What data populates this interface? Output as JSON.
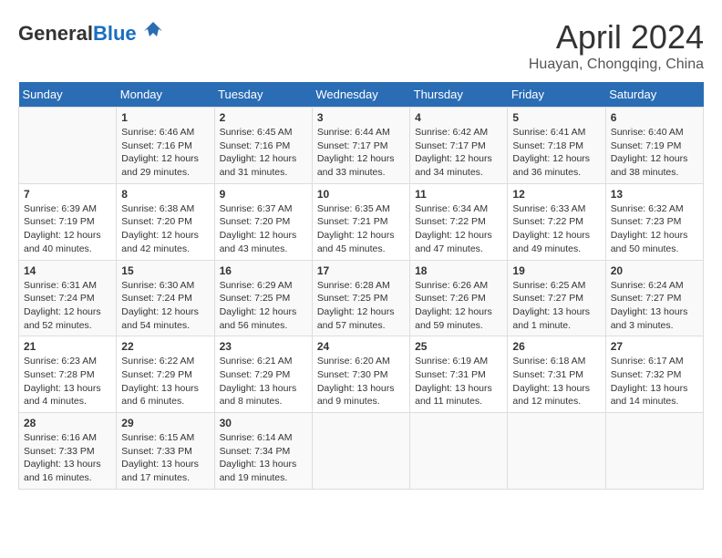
{
  "header": {
    "logo_general": "General",
    "logo_blue": "Blue",
    "month_title": "April 2024",
    "location": "Huayan, Chongqing, China"
  },
  "weekdays": [
    "Sunday",
    "Monday",
    "Tuesday",
    "Wednesday",
    "Thursday",
    "Friday",
    "Saturday"
  ],
  "weeks": [
    [
      {
        "day": "",
        "sunrise": "",
        "sunset": "",
        "daylight": ""
      },
      {
        "day": "1",
        "sunrise": "Sunrise: 6:46 AM",
        "sunset": "Sunset: 7:16 PM",
        "daylight": "Daylight: 12 hours and 29 minutes."
      },
      {
        "day": "2",
        "sunrise": "Sunrise: 6:45 AM",
        "sunset": "Sunset: 7:16 PM",
        "daylight": "Daylight: 12 hours and 31 minutes."
      },
      {
        "day": "3",
        "sunrise": "Sunrise: 6:44 AM",
        "sunset": "Sunset: 7:17 PM",
        "daylight": "Daylight: 12 hours and 33 minutes."
      },
      {
        "day": "4",
        "sunrise": "Sunrise: 6:42 AM",
        "sunset": "Sunset: 7:17 PM",
        "daylight": "Daylight: 12 hours and 34 minutes."
      },
      {
        "day": "5",
        "sunrise": "Sunrise: 6:41 AM",
        "sunset": "Sunset: 7:18 PM",
        "daylight": "Daylight: 12 hours and 36 minutes."
      },
      {
        "day": "6",
        "sunrise": "Sunrise: 6:40 AM",
        "sunset": "Sunset: 7:19 PM",
        "daylight": "Daylight: 12 hours and 38 minutes."
      }
    ],
    [
      {
        "day": "7",
        "sunrise": "Sunrise: 6:39 AM",
        "sunset": "Sunset: 7:19 PM",
        "daylight": "Daylight: 12 hours and 40 minutes."
      },
      {
        "day": "8",
        "sunrise": "Sunrise: 6:38 AM",
        "sunset": "Sunset: 7:20 PM",
        "daylight": "Daylight: 12 hours and 42 minutes."
      },
      {
        "day": "9",
        "sunrise": "Sunrise: 6:37 AM",
        "sunset": "Sunset: 7:20 PM",
        "daylight": "Daylight: 12 hours and 43 minutes."
      },
      {
        "day": "10",
        "sunrise": "Sunrise: 6:35 AM",
        "sunset": "Sunset: 7:21 PM",
        "daylight": "Daylight: 12 hours and 45 minutes."
      },
      {
        "day": "11",
        "sunrise": "Sunrise: 6:34 AM",
        "sunset": "Sunset: 7:22 PM",
        "daylight": "Daylight: 12 hours and 47 minutes."
      },
      {
        "day": "12",
        "sunrise": "Sunrise: 6:33 AM",
        "sunset": "Sunset: 7:22 PM",
        "daylight": "Daylight: 12 hours and 49 minutes."
      },
      {
        "day": "13",
        "sunrise": "Sunrise: 6:32 AM",
        "sunset": "Sunset: 7:23 PM",
        "daylight": "Daylight: 12 hours and 50 minutes."
      }
    ],
    [
      {
        "day": "14",
        "sunrise": "Sunrise: 6:31 AM",
        "sunset": "Sunset: 7:24 PM",
        "daylight": "Daylight: 12 hours and 52 minutes."
      },
      {
        "day": "15",
        "sunrise": "Sunrise: 6:30 AM",
        "sunset": "Sunset: 7:24 PM",
        "daylight": "Daylight: 12 hours and 54 minutes."
      },
      {
        "day": "16",
        "sunrise": "Sunrise: 6:29 AM",
        "sunset": "Sunset: 7:25 PM",
        "daylight": "Daylight: 12 hours and 56 minutes."
      },
      {
        "day": "17",
        "sunrise": "Sunrise: 6:28 AM",
        "sunset": "Sunset: 7:25 PM",
        "daylight": "Daylight: 12 hours and 57 minutes."
      },
      {
        "day": "18",
        "sunrise": "Sunrise: 6:26 AM",
        "sunset": "Sunset: 7:26 PM",
        "daylight": "Daylight: 12 hours and 59 minutes."
      },
      {
        "day": "19",
        "sunrise": "Sunrise: 6:25 AM",
        "sunset": "Sunset: 7:27 PM",
        "daylight": "Daylight: 13 hours and 1 minute."
      },
      {
        "day": "20",
        "sunrise": "Sunrise: 6:24 AM",
        "sunset": "Sunset: 7:27 PM",
        "daylight": "Daylight: 13 hours and 3 minutes."
      }
    ],
    [
      {
        "day": "21",
        "sunrise": "Sunrise: 6:23 AM",
        "sunset": "Sunset: 7:28 PM",
        "daylight": "Daylight: 13 hours and 4 minutes."
      },
      {
        "day": "22",
        "sunrise": "Sunrise: 6:22 AM",
        "sunset": "Sunset: 7:29 PM",
        "daylight": "Daylight: 13 hours and 6 minutes."
      },
      {
        "day": "23",
        "sunrise": "Sunrise: 6:21 AM",
        "sunset": "Sunset: 7:29 PM",
        "daylight": "Daylight: 13 hours and 8 minutes."
      },
      {
        "day": "24",
        "sunrise": "Sunrise: 6:20 AM",
        "sunset": "Sunset: 7:30 PM",
        "daylight": "Daylight: 13 hours and 9 minutes."
      },
      {
        "day": "25",
        "sunrise": "Sunrise: 6:19 AM",
        "sunset": "Sunset: 7:31 PM",
        "daylight": "Daylight: 13 hours and 11 minutes."
      },
      {
        "day": "26",
        "sunrise": "Sunrise: 6:18 AM",
        "sunset": "Sunset: 7:31 PM",
        "daylight": "Daylight: 13 hours and 12 minutes."
      },
      {
        "day": "27",
        "sunrise": "Sunrise: 6:17 AM",
        "sunset": "Sunset: 7:32 PM",
        "daylight": "Daylight: 13 hours and 14 minutes."
      }
    ],
    [
      {
        "day": "28",
        "sunrise": "Sunrise: 6:16 AM",
        "sunset": "Sunset: 7:33 PM",
        "daylight": "Daylight: 13 hours and 16 minutes."
      },
      {
        "day": "29",
        "sunrise": "Sunrise: 6:15 AM",
        "sunset": "Sunset: 7:33 PM",
        "daylight": "Daylight: 13 hours and 17 minutes."
      },
      {
        "day": "30",
        "sunrise": "Sunrise: 6:14 AM",
        "sunset": "Sunset: 7:34 PM",
        "daylight": "Daylight: 13 hours and 19 minutes."
      },
      {
        "day": "",
        "sunrise": "",
        "sunset": "",
        "daylight": ""
      },
      {
        "day": "",
        "sunrise": "",
        "sunset": "",
        "daylight": ""
      },
      {
        "day": "",
        "sunrise": "",
        "sunset": "",
        "daylight": ""
      },
      {
        "day": "",
        "sunrise": "",
        "sunset": "",
        "daylight": ""
      }
    ]
  ]
}
